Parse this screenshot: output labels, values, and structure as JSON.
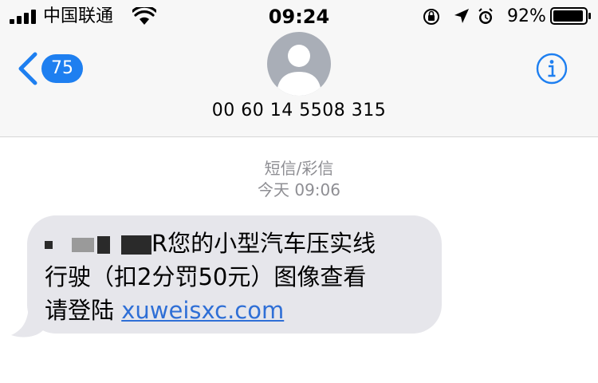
{
  "status_bar": {
    "carrier": "中国联通",
    "time": "09:24",
    "battery_percent": "92%",
    "icons": [
      "signal-icon",
      "wifi-icon",
      "orientation-lock-icon",
      "location-arrow-icon",
      "alarm-icon",
      "battery-icon"
    ]
  },
  "nav": {
    "unread_count": "75",
    "contact_number": "00 60 14 5508 315"
  },
  "conversation": {
    "message_type": "短信/彩信",
    "timestamp": "今天 09:06",
    "messages": [
      {
        "direction": "incoming",
        "redacted_prefix_visible": "R",
        "text_line1": "您的小型汽车压实线",
        "text_line2": "行驶（扣2分罚50元）图像查看",
        "text_line3": "请登陆 ",
        "link": "xuweisxc.com"
      }
    ]
  },
  "colors": {
    "accent_blue": "#1e7ff0",
    "link_blue": "#2f6fd6",
    "bubble_gray": "#e6e6eb",
    "header_bg": "#f7f7f7",
    "meta_gray": "#8e8e93"
  }
}
